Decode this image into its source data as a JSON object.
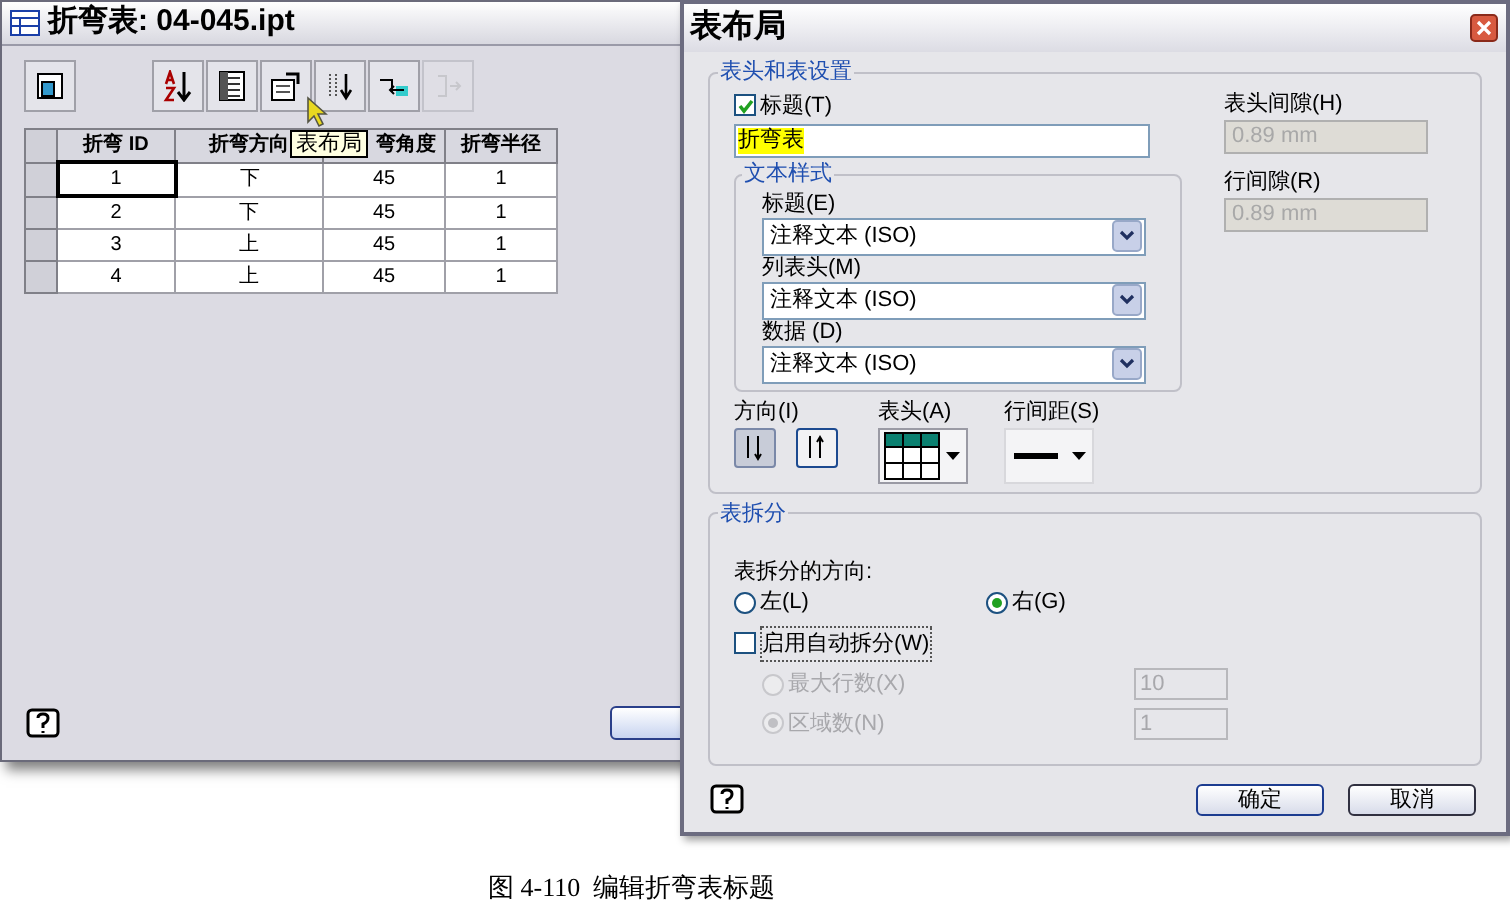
{
  "left_window": {
    "title": "折弯表: 04-045.ipt",
    "toolbar": [
      {
        "disabled": false
      },
      {
        "disabled": false
      },
      {
        "disabled": false
      },
      {
        "disabled": false
      },
      {
        "disabled": false
      },
      {
        "disabled": false
      },
      {
        "disabled": true
      }
    ],
    "tooltip": "表布局",
    "table": {
      "columns": [
        "折弯 ID",
        "折弯方向",
        "弯角度",
        "折弯半径"
      ],
      "rows": [
        {
          "focused": true,
          "cells": [
            "1",
            "下",
            "45",
            "1"
          ]
        },
        {
          "focused": false,
          "cells": [
            "2",
            "下",
            "45",
            "1"
          ]
        },
        {
          "focused": false,
          "cells": [
            "3",
            "上",
            "45",
            "1"
          ]
        },
        {
          "focused": false,
          "cells": [
            "4",
            "上",
            "45",
            "1"
          ]
        }
      ]
    }
  },
  "dialog": {
    "title": "表布局",
    "header_group": {
      "title": "表头和表设置",
      "title_checkbox": {
        "label": "标题(T)",
        "checked": true
      },
      "title_value": "折弯表",
      "header_gap": {
        "label": "表头间隙(H)",
        "value": "0.89 mm",
        "disabled": true
      },
      "row_gap": {
        "label": "行间隙(R)",
        "value": "0.89 mm",
        "disabled": true
      },
      "text_style": {
        "title": "文本样式",
        "selects": [
          {
            "label": "标题(E)",
            "value": "注释文本 (ISO)"
          },
          {
            "label": "列表头(M)",
            "value": "注释文本 (ISO)"
          },
          {
            "label": "数据 (D)",
            "value": "注释文本 (ISO)"
          }
        ]
      },
      "direction": {
        "label": "方向(I)",
        "options": [
          {
            "selected": true
          },
          {
            "selected": false
          }
        ]
      },
      "header_label": "表头(A)",
      "row_spacing_label": "行间距(S)"
    },
    "split_group": {
      "title": "表拆分",
      "direction_label": "表拆分的方向:",
      "radios": [
        {
          "label": "左(L)",
          "selected": false
        },
        {
          "label": "右(G)",
          "selected": true
        }
      ],
      "auto_split": {
        "label": "启用自动拆分(W)",
        "checked": false
      },
      "options": [
        {
          "label": "最大行数(X)",
          "selected": false,
          "value": "10",
          "disabled": true
        },
        {
          "label": "区域数(N)",
          "selected": true,
          "value": "1",
          "disabled": true
        }
      ]
    },
    "buttons": [
      "确定",
      "取消"
    ]
  },
  "caption": "图 4-110  编辑折弯表标题"
}
